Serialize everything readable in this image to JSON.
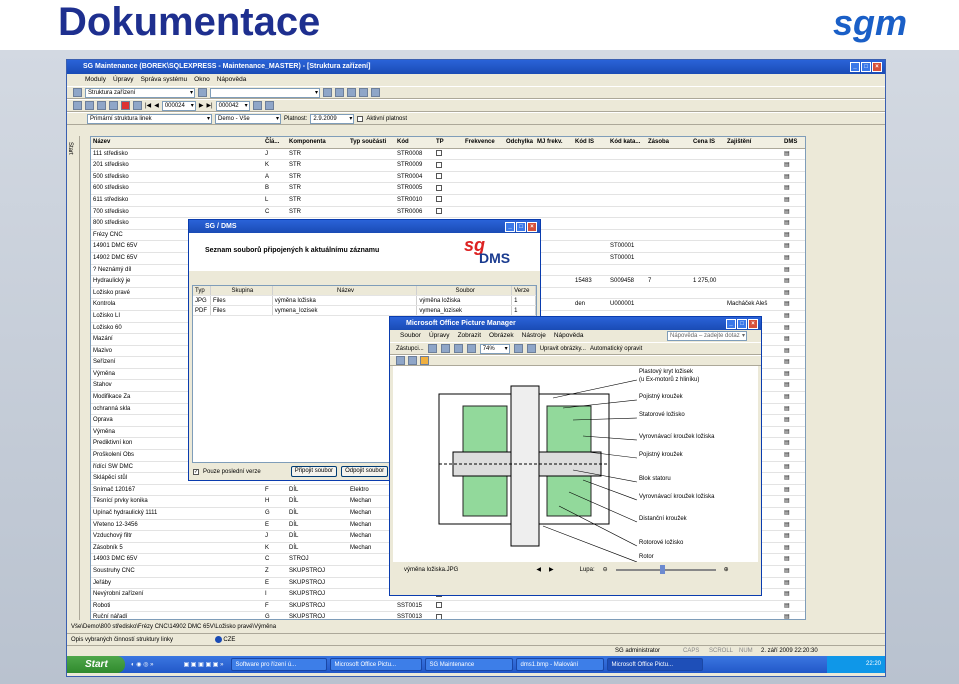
{
  "slide": {
    "title": "Dokumentace",
    "logo": "sgm"
  },
  "main_window": {
    "title": "SG Maintenance (BOREK\\SQLEXPRESS - Maintenance_MASTER) - [Struktura zařízení]",
    "menu": [
      "Moduly",
      "Úpravy",
      "Správa systému",
      "Okno",
      "Nápověda"
    ],
    "menu_help": "Nápověda",
    "struct_combo": "Struktura zařízení",
    "record_no": "000024",
    "record_total": "000042",
    "filter_combo": "Primární struktura linek",
    "demo_combo": "Demo - Vše",
    "plat_label": "Platnost:",
    "plat_date": "2.9.2009",
    "active_label": "Aktivní platnost",
    "side_label": "Start"
  },
  "grid": {
    "columns": [
      "Název",
      "Čĺá...",
      "Komponenta",
      "Typ součásti",
      "Kód",
      "TP",
      "Frekvence",
      "Odchylka",
      "MJ frekv.",
      "Kód IS",
      "Kód kata...",
      "Zásoba",
      "Cena IS",
      "Zajištění",
      "DMS"
    ],
    "rows": [
      {
        "name": "111 středisko",
        "c": "J",
        "k": "STR",
        "kod": "STR0008"
      },
      {
        "name": "201 středisko",
        "c": "K",
        "k": "STR",
        "kod": "STR0009"
      },
      {
        "name": "500 středisko",
        "c": "A",
        "k": "STR",
        "kod": "STR0004"
      },
      {
        "name": "600 středisko",
        "c": "B",
        "k": "STR",
        "kod": "STR0005"
      },
      {
        "name": "611 středisko",
        "c": "L",
        "k": "STR",
        "kod": "STR0010"
      },
      {
        "name": "700 středisko",
        "c": "C",
        "k": "STR",
        "kod": "STR0006"
      },
      {
        "name": "800 středisko",
        "c": "",
        "k": "",
        "kod": ""
      },
      {
        "name": "Frézy CNC",
        "c": "",
        "k": "",
        "kod": ""
      },
      {
        "name": "14901 DMC 65V",
        "c": "",
        "k": "",
        "kod": "",
        "kis": "ST00001"
      },
      {
        "name": "14902 DMC 65V",
        "c": "",
        "k": "",
        "kod": "",
        "kis": "ST00001"
      },
      {
        "name": "? Neznámý díl",
        "c": "",
        "k": "",
        "kod": ""
      },
      {
        "name": "Hydraulický je",
        "c": "",
        "k": "",
        "kod": "",
        "kodis": "15483",
        "kk": "S009458",
        "z": "7",
        "cena": "1 275,00"
      },
      {
        "name": "Ložisko pravé",
        "c": "",
        "k": "",
        "kod": ""
      },
      {
        "name": "Kontrola",
        "c": "",
        "k": "",
        "kod": "",
        "kodis": "den",
        "kk": "U000001",
        "za": "Macháček Aleš"
      },
      {
        "name": "Ložisko LI",
        "c": "",
        "k": "",
        "kod": ""
      },
      {
        "name": "Ložisko 60",
        "c": "",
        "k": "",
        "kod": ""
      },
      {
        "name": "Mazání",
        "c": "",
        "k": "",
        "kod": ""
      },
      {
        "name": "Mazivo",
        "c": "",
        "k": "",
        "kod": ""
      },
      {
        "name": "Seřízení",
        "c": "",
        "k": "",
        "kod": ""
      },
      {
        "name": "Výměna",
        "c": "",
        "k": "",
        "kod": ""
      },
      {
        "name": "Stahov",
        "c": "",
        "k": "",
        "kod": ""
      },
      {
        "name": "Modifikace Za",
        "c": "",
        "k": "",
        "kod": ""
      },
      {
        "name": "ochranná skla",
        "c": "",
        "k": "",
        "kod": ""
      },
      {
        "name": "Oprava",
        "c": "",
        "k": "",
        "kod": ""
      },
      {
        "name": "Výměna",
        "c": "",
        "k": "",
        "kod": ""
      },
      {
        "name": "Prediktivní kon",
        "c": "",
        "k": "",
        "kod": ""
      },
      {
        "name": "Proškolení Obs",
        "c": "",
        "k": "",
        "kod": ""
      },
      {
        "name": "řídící SW DMC",
        "c": "",
        "k": "",
        "kod": ""
      },
      {
        "name": "Sklápěcí stůl",
        "c": "",
        "k": "",
        "kod": ""
      },
      {
        "name": "Snímač 120167",
        "c": "F",
        "k": "DÍL",
        "t": "Elektro"
      },
      {
        "name": "Těsnící prvky konika",
        "c": "H",
        "k": "DÍL",
        "t": "Mechan"
      },
      {
        "name": "Upínač hydraulický 1111",
        "c": "G",
        "k": "DÍL",
        "t": "Mechan"
      },
      {
        "name": "Vřeteno 12-3456",
        "c": "E",
        "k": "DÍL",
        "t": "Mechan"
      },
      {
        "name": "Vzduchový filtr",
        "c": "J",
        "k": "DÍL",
        "t": "Mechan"
      },
      {
        "name": "Zásobník 5",
        "c": "K",
        "k": "DÍL",
        "t": "Mechan"
      },
      {
        "name": "14903 DMC 65V",
        "c": "C",
        "k": "STROJ",
        "t": ""
      },
      {
        "name": "Soustruhy CNC",
        "c": "Z",
        "k": "SKUPSTROJ",
        "t": ""
      },
      {
        "name": "Jeřáby",
        "c": "E",
        "k": "SKUPSTROJ",
        "t": ""
      },
      {
        "name": "Nevýrobní zařízení",
        "c": "I",
        "k": "SKUPSTROJ",
        "t": ""
      },
      {
        "name": "Roboti",
        "c": "F",
        "k": "SKUPSTROJ",
        "kod": "SST0015"
      },
      {
        "name": "Ruční nářadí",
        "c": "G",
        "k": "SKUPSTROJ",
        "kod": "SST0013"
      }
    ]
  },
  "status": {
    "path": "Vše\\Demo\\800 středisko\\Frézy CNC\\14902 DMC 65V\\Ložisko pravé\\Výměna",
    "opis": "Opis vybraných činností struktury linky",
    "lang": "CZE",
    "user": "SG administrator",
    "caps": "CAPS",
    "scroll": "SCROLL",
    "num": "NUM",
    "datetime": "2. září 2009 22:20:30"
  },
  "taskbar": {
    "start": "Start",
    "tasks": [
      "Software pro řízení ú...",
      "Microsoft Office Pictu...",
      "SG Maintenance",
      "dms1.bmp - Malování",
      "Microsoft Office Pictu..."
    ],
    "clock": "22:20"
  },
  "dms_dialog": {
    "title": "SG / DMS",
    "header": "Seznam souborů připojených k aktuálnímu záznamu",
    "logo_sg": "sg",
    "logo_dms": "DMS",
    "columns": [
      "Typ",
      "Skupina",
      "Název",
      "Soubor",
      "Verze"
    ],
    "rows": [
      {
        "typ": "JPG",
        "sk": "Files",
        "naz": "výměna ložiska",
        "sou": "výměna ložiska",
        "ver": "1"
      },
      {
        "typ": "PDF",
        "sk": "Files",
        "naz": "vymena_lozisek",
        "sou": "vymena_lozisek",
        "ver": "1"
      }
    ],
    "only_last": "Pouze poslední verze",
    "attach_btn": "Připojit soubor",
    "detach_btn": "Odpojit soubor"
  },
  "picture_manager": {
    "title": "Microsoft Office Picture Manager",
    "menu": [
      "Soubor",
      "Úpravy",
      "Zobrazit",
      "Obrázek",
      "Nástroje",
      "Nápověda"
    ],
    "help_placeholder": "Nápověda – zadejte dotaz",
    "shortcuts": "Zástupci...",
    "zoom": "74%",
    "edit_btn": "Upravit obrázky...",
    "auto_btn": "Automatický opravit",
    "filename": "výměna ložiska.JPG",
    "zoom_label": "Lupa:",
    "labels": [
      "Plastový kryt ložisek",
      "(u Ex-motorů z hliníku)",
      "Pojistný kroužek",
      "Statorové ložisko",
      "Vyrovnávací kroužek ložiska",
      "Pojistný kroužek",
      "Blok statoru",
      "Vyrovnávací kroužek ložiska",
      "Distanční kroužek",
      "Rotorové ložisko",
      "Rotor"
    ]
  }
}
